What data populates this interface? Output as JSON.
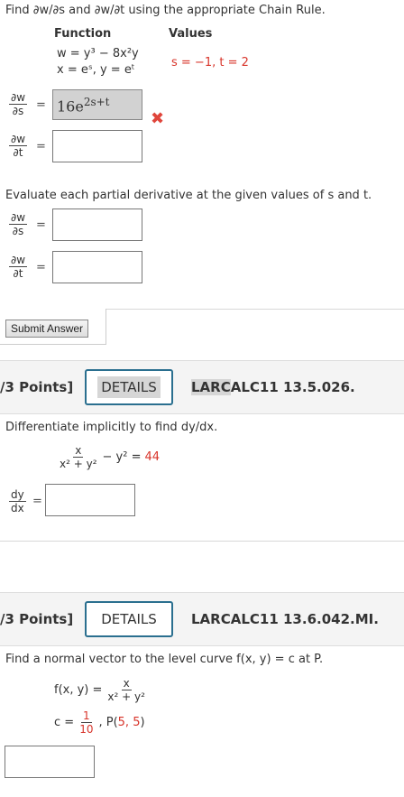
{
  "q1": {
    "prompt": "Find ∂w/∂s and ∂w/∂t using the appropriate Chain Rule.",
    "function_header": "Function",
    "values_header": "Values",
    "function_line1": "w = y³ − 8x²y",
    "function_line2": "x = eˢ,  y = eᵗ",
    "values_text": "s = −1,  t = 2",
    "dw_ds_answer": "16e",
    "dw_ds_exp": "2s+t",
    "incorrect_icon": "x-mark-icon",
    "evaluate_prompt": "Evaluate each partial derivative at the given values of s and t.",
    "submit_label": "Submit Answer"
  },
  "deriv": {
    "dw": "∂w",
    "ds": "∂s",
    "dt": "∂t",
    "dy": "dy",
    "dx": "dx",
    "equals": "="
  },
  "q2": {
    "points": "/3 Points]",
    "details_label": "DETAILS",
    "ref_highlight": "LARC",
    "ref_rest": "ALC11 13.5.026.",
    "prompt": "Differentiate implicitly to find dy/dx.",
    "eq_num": "x",
    "eq_den": "x² + y²",
    "eq_rest": "− y² =",
    "eq_value": "44"
  },
  "q3": {
    "points": "/3 Points]",
    "details_label": "DETAILS",
    "ref": "LARCALC11 13.6.042.MI.",
    "prompt": "Find a normal vector to the level curve  f(x, y) = c at P.",
    "f_lhs": "f(x, y) =",
    "f_num": "x",
    "f_den": "x² + y²",
    "c_lhs": "c =",
    "c_num": "1",
    "c_den": "10",
    "point_label": ",    P(",
    "point_value": "5, 5",
    "point_close": ")"
  },
  "colors": {
    "accent_border": "#2a6f8f",
    "given_value_red": "#d8342a",
    "incorrect_red": "#e0453b"
  }
}
